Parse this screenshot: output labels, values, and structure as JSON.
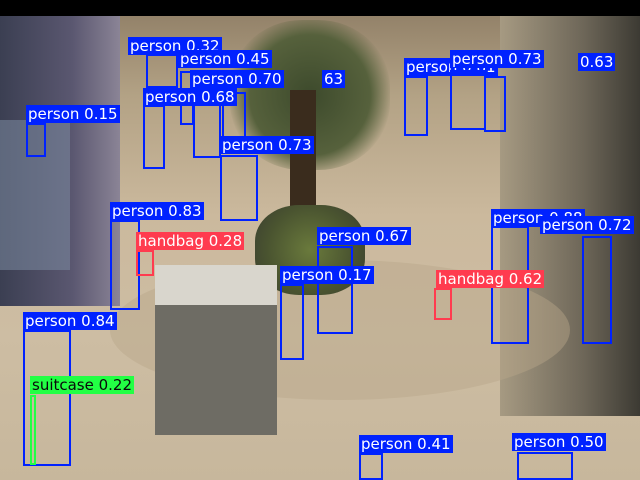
{
  "detections": [
    {
      "label": "person 0.32",
      "color": "#0022ff",
      "class": "person"
    },
    {
      "label": "person 0.45",
      "color": "#0022ff",
      "class": "person"
    },
    {
      "label": "person 0.70",
      "color": "#0022ff",
      "class": "person"
    },
    {
      "label": "63",
      "color": "#0022ff",
      "class": "person"
    },
    {
      "label": "person 0.68",
      "color": "#0022ff",
      "class": "person"
    },
    {
      "label": "person 0.15",
      "color": "#0022ff",
      "class": "person"
    },
    {
      "label": "person 0.73",
      "color": "#0022ff",
      "class": "person"
    },
    {
      "label": "person 0.81",
      "color": "#0022ff",
      "class": "person"
    },
    {
      "label": "person 0.73",
      "color": "#0022ff",
      "class": "person"
    },
    {
      "label": "0.63",
      "color": "#0022ff",
      "class": "person"
    },
    {
      "label": "person 0.83",
      "color": "#0022ff",
      "class": "person"
    },
    {
      "label": "handbag 0.28",
      "color": "#ff3b4f",
      "class": "handbag"
    },
    {
      "label": "person 0.67",
      "color": "#0022ff",
      "class": "person"
    },
    {
      "label": "person 0.88",
      "color": "#0022ff",
      "class": "person"
    },
    {
      "label": "person 0.72",
      "color": "#0022ff",
      "class": "person"
    },
    {
      "label": "person 0.17",
      "color": "#0022ff",
      "class": "person"
    },
    {
      "label": "handbag 0.62",
      "color": "#ff3b4f",
      "class": "handbag"
    },
    {
      "label": "person 0.84",
      "color": "#0022ff",
      "class": "person"
    },
    {
      "label": "suitcase 0.22",
      "color": "#22ff44",
      "class": "suitcase"
    },
    {
      "label": "person 0.41",
      "color": "#0022ff",
      "class": "person"
    },
    {
      "label": "person 0.50",
      "color": "#0022ff",
      "class": "person"
    }
  ]
}
